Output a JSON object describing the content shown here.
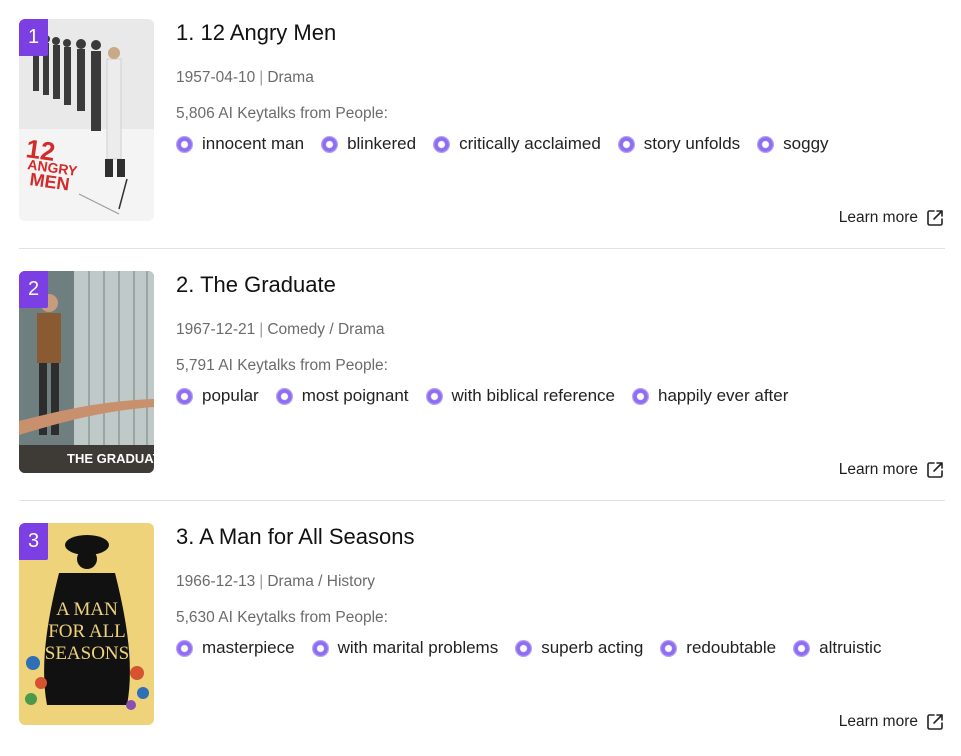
{
  "items": [
    {
      "rank": "1",
      "title": "1. 12 Angry Men",
      "date": "1957-04-10",
      "separator": "|",
      "genres": "Drama",
      "keytalks": "5,806 AI Keytalks from People:",
      "tags": [
        "innocent man",
        "blinkered",
        "critically acclaimed",
        "story unfolds",
        "soggy"
      ],
      "learn_more": "Learn more",
      "poster_text": "12 ANGRY MEN"
    },
    {
      "rank": "2",
      "title": "2. The Graduate",
      "date": "1967-12-21",
      "separator": "|",
      "genres": "Comedy / Drama",
      "keytalks": "5,791 AI Keytalks from People:",
      "tags": [
        "popular",
        "most poignant",
        "with biblical reference",
        "happily ever after"
      ],
      "learn_more": "Learn more",
      "poster_text": "THE GRADUATE"
    },
    {
      "rank": "3",
      "title": "3. A Man for All Seasons",
      "date": "1966-12-13",
      "separator": "|",
      "genres": "Drama / History",
      "keytalks": "5,630 AI Keytalks from People:",
      "tags": [
        "masterpiece",
        "with marital problems",
        "superb acting",
        "redoubtable",
        "altruistic"
      ],
      "learn_more": "Learn more",
      "poster_text": "A MAN FOR ALL SEASONS"
    }
  ],
  "colors": {
    "rank_badge": "#7b3fe4",
    "tag_dot": "#8f6df2",
    "divider": "#e2e2e2"
  },
  "icons": {
    "tag": "keytalk-dot-icon",
    "learn_more": "external-link-icon"
  }
}
